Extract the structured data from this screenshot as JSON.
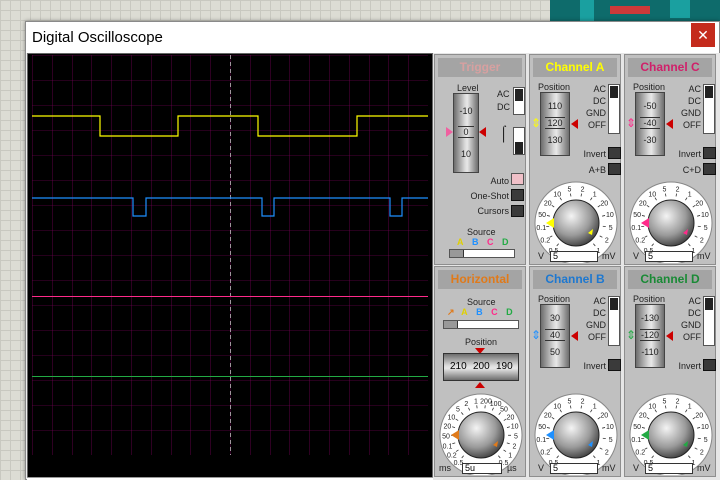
{
  "window": {
    "title": "Digital Oscilloscope",
    "close": "✕"
  },
  "colors": {
    "chA": "#ffff00",
    "chB": "#1e90ff",
    "chC": "#ff2a8a",
    "chD": "#22aa44",
    "grid": "#800060"
  },
  "trigger": {
    "title": "Trigger",
    "level_label": "Level",
    "roller": [
      "-10",
      "0",
      "10"
    ],
    "ac": "AC",
    "dc": "DC",
    "auto": "Auto",
    "one_shot": "One-Shot",
    "cursors": "Cursors",
    "source_label": "Source",
    "sources": [
      "A",
      "B",
      "C",
      "D"
    ]
  },
  "horizontal": {
    "title": "Horizontal",
    "source_label": "Source",
    "sources": [
      "A",
      "B",
      "C",
      "D"
    ],
    "position_label": "Position",
    "position_values": [
      "210",
      "200",
      "190"
    ],
    "input": "5u",
    "unit_left": "ms",
    "unit_right": "µs",
    "dial_labels": [
      "0.5",
      "0.2",
      "0.1",
      "50",
      "20",
      "10",
      "5",
      "2",
      "1",
      "200",
      "100",
      "50",
      "20",
      "10",
      "5",
      "2",
      "1",
      "0.5"
    ]
  },
  "channels": [
    {
      "key": "A",
      "title": "Channel A",
      "pos_label": "Position",
      "roller": [
        "110",
        "120",
        "130"
      ],
      "ac": "AC",
      "dc": "DC",
      "gnd": "GND",
      "off": "OFF",
      "invert": "Invert",
      "extra": "A+B",
      "input": "5",
      "u_left": "V",
      "u_right": "mV",
      "dial": [
        "0.5",
        "0.2",
        "0.1",
        "50",
        "20",
        "10",
        "5",
        "2",
        "1",
        "20",
        "10",
        "5",
        "2",
        "1"
      ]
    },
    {
      "key": "C",
      "title": "Channel C",
      "pos_label": "Position",
      "roller": [
        "-50",
        "-40",
        "-30"
      ],
      "ac": "AC",
      "dc": "DC",
      "gnd": "GND",
      "off": "OFF",
      "invert": "Invert",
      "extra": "C+D",
      "input": "5",
      "u_left": "V",
      "u_right": "mV",
      "dial": [
        "0.5",
        "0.2",
        "0.1",
        "50",
        "20",
        "10",
        "5",
        "2",
        "1",
        "20",
        "10",
        "5",
        "2",
        "1"
      ]
    },
    {
      "key": "B",
      "title": "Channel B",
      "pos_label": "Position",
      "roller": [
        "30",
        "40",
        "50"
      ],
      "ac": "AC",
      "dc": "DC",
      "gnd": "GND",
      "off": "OFF",
      "invert": "Invert",
      "extra": "",
      "input": "5",
      "u_left": "V",
      "u_right": "mV",
      "dial": [
        "0.5",
        "0.2",
        "0.1",
        "50",
        "20",
        "10",
        "5",
        "2",
        "1",
        "20",
        "10",
        "5",
        "2",
        "1"
      ]
    },
    {
      "key": "D",
      "title": "Channel D",
      "pos_label": "Position",
      "roller": [
        "-130",
        "-120",
        "-110"
      ],
      "ac": "AC",
      "dc": "DC",
      "gnd": "GND",
      "off": "OFF",
      "invert": "Invert",
      "extra": "",
      "input": "5",
      "u_left": "V",
      "u_right": "mV",
      "dial": [
        "0.5",
        "0.2",
        "0.1",
        "50",
        "20",
        "10",
        "5",
        "2",
        "1",
        "20",
        "10",
        "5",
        "2",
        "1"
      ]
    }
  ]
}
